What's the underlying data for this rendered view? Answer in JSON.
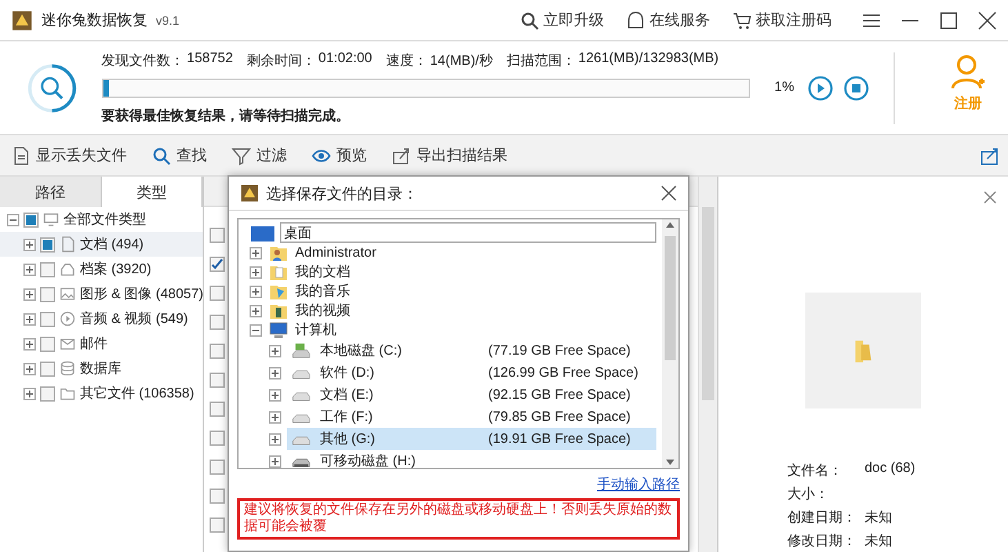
{
  "window": {
    "title": "迷你兔数据恢复",
    "version": "v9.1",
    "actions": [
      "立即升级",
      "在线服务",
      "获取注册码"
    ]
  },
  "scan": {
    "stats": [
      {
        "label": "发现文件数：",
        "value": "158752"
      },
      {
        "label": "剩余时间：",
        "value": "01:02:00"
      },
      {
        "label": "速度：",
        "value": "14(MB)/秒"
      },
      {
        "label": "扫描范围：",
        "value": "1261(MB)/132983(MB)"
      }
    ],
    "level": 0.01,
    "percent": "1%",
    "hint": "要获得最佳恢复结果，请等待扫描完成。",
    "register": "注册"
  },
  "toolbar": [
    {
      "label": "显示丢失文件",
      "kind": "file"
    },
    {
      "label": "查找",
      "kind": "search"
    },
    {
      "label": "过滤",
      "kind": "filter"
    },
    {
      "label": "预览",
      "kind": "eye"
    },
    {
      "label": "导出扫描结果",
      "kind": "export"
    }
  ],
  "left_tabs": [
    {
      "label": "路径",
      "selected": false
    },
    {
      "label": "类型",
      "selected": true
    }
  ],
  "type_tree": {
    "label": "全部文件类型",
    "checked": true,
    "children": [
      {
        "label": "文档 (494)",
        "kind": "doc",
        "checked": true,
        "selected": true
      },
      {
        "label": "档案 (3920)",
        "kind": "archive",
        "checked": false,
        "selected": false
      },
      {
        "label": "图形 & 图像 (48057)",
        "kind": "image",
        "checked": false,
        "selected": false
      },
      {
        "label": "音频 & 视频 (549)",
        "kind": "play",
        "checked": false,
        "selected": false
      },
      {
        "label": "邮件",
        "kind": "mail",
        "checked": false,
        "selected": false
      },
      {
        "label": "数据库",
        "kind": "database",
        "checked": false,
        "selected": false
      },
      {
        "label": "其它文件 (106358)",
        "kind": "folder",
        "checked": false,
        "selected": false
      }
    ]
  },
  "file_list": {
    "rows": [
      {
        "checked": false
      },
      {
        "checked": true
      },
      {
        "checked": false
      },
      {
        "checked": false
      },
      {
        "checked": false
      },
      {
        "checked": false
      },
      {
        "checked": false
      },
      {
        "checked": false
      },
      {
        "checked": false
      },
      {
        "checked": false
      },
      {
        "checked": false
      }
    ]
  },
  "dialog": {
    "title": "选择保存文件的目录：",
    "root": "桌面",
    "tree": [
      {
        "label": "Administrator",
        "kind": "user",
        "expanded": false
      },
      {
        "label": "我的文档",
        "kind": "docs",
        "expanded": false
      },
      {
        "label": "我的音乐",
        "kind": "music",
        "expanded": false
      },
      {
        "label": "我的视频",
        "kind": "video",
        "expanded": false
      },
      {
        "label": "计算机",
        "kind": "computer",
        "expanded": true,
        "children": [
          {
            "label": "本地磁盘 (C:)",
            "space": "(77.19 GB Free Space)",
            "kind": "system",
            "selected": false
          },
          {
            "label": "软件 (D:)",
            "space": "(126.99 GB Free Space)",
            "kind": "drive",
            "selected": false
          },
          {
            "label": "文档 (E:)",
            "space": "(92.15 GB Free Space)",
            "kind": "drive",
            "selected": false
          },
          {
            "label": "工作 (F:)",
            "space": "(79.85 GB Free Space)",
            "kind": "drive",
            "selected": false
          },
          {
            "label": "其他 (G:)",
            "space": "(19.91 GB Free Space)",
            "kind": "drive",
            "selected": true
          },
          {
            "label": "可移动磁盘 (H:)",
            "kind": "usb",
            "selected": false
          }
        ]
      }
    ],
    "link": "手动输入路径",
    "warning": "建议将恢复的文件保存在另外的磁盘或移动硬盘上！否则丢失原始的数据可能会被覆"
  },
  "preview": {
    "fields": [
      {
        "label": "文件名：",
        "value": "doc (68)"
      },
      {
        "label": "大小："
      },
      {
        "label": "创建日期：",
        "value": "未知"
      },
      {
        "label": "修改日期：",
        "value": "未知"
      }
    ]
  }
}
